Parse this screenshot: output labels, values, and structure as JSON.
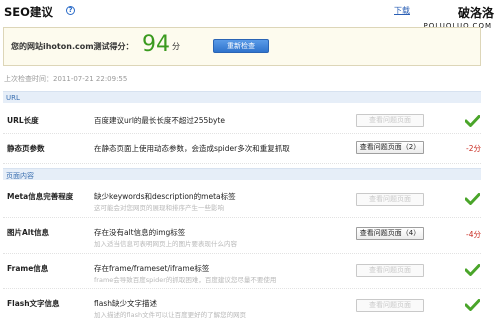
{
  "header": {
    "title": "SEO建议",
    "help": "?",
    "top_link": "下载",
    "watermark_cn": "破洛洛",
    "watermark_en": "POLUOLUO.COM"
  },
  "score": {
    "label": "您的网站ihoton.com测试得分：",
    "value": "94",
    "unit": "分",
    "recheck_label": "重新检查"
  },
  "last_check": "上次检查时间：2011-07-21 22:09:55",
  "colors": {
    "accent": "#3a9a1e",
    "penalty": "#c8281e",
    "button": "#2f73cc",
    "section": "#e6eef8"
  },
  "sections": [
    {
      "title": "URL",
      "rows": [
        {
          "label": "URL长度",
          "desc": "百度建议url的最长长度不超过255byte",
          "sub": "",
          "button": "查看问题页面",
          "button_enabled": false,
          "result": "check-icon"
        },
        {
          "label": "静态页参数",
          "desc": "在静态页面上使用动态参数，会造成spider多次和重复抓取",
          "sub": "",
          "button": "查看问题页面（2）",
          "button_enabled": true,
          "result": "-2分"
        }
      ]
    },
    {
      "title": "页面内容",
      "rows": [
        {
          "label": "Meta信息完善程度",
          "desc": "缺少keywords和description的meta标签",
          "sub": "这可能会对您网页的展现和排序产生一些影响",
          "button": "查看问题页面",
          "button_enabled": false,
          "result": "check-icon"
        },
        {
          "label": "图片Alt信息",
          "desc": "存在没有alt信息的img标签",
          "sub": "加入适当信息可表明网页上的图片要表现什么内容",
          "button": "查看问题页面（4）",
          "button_enabled": true,
          "result": "-4分"
        },
        {
          "label": "Frame信息",
          "desc": "存在frame/frameset/iframe标签",
          "sub": "frame会导致百度spider的抓取困难，百度建议您尽量不要使用",
          "button": "查看问题页面",
          "button_enabled": false,
          "result": "check-icon"
        },
        {
          "label": "Flash文字信息",
          "desc": "flash缺少文字描述",
          "sub": "加入描述的flash文件可以让百度更好的了解您的网页",
          "button": "查看问题页面",
          "button_enabled": false,
          "result": "check-icon"
        }
      ]
    }
  ]
}
